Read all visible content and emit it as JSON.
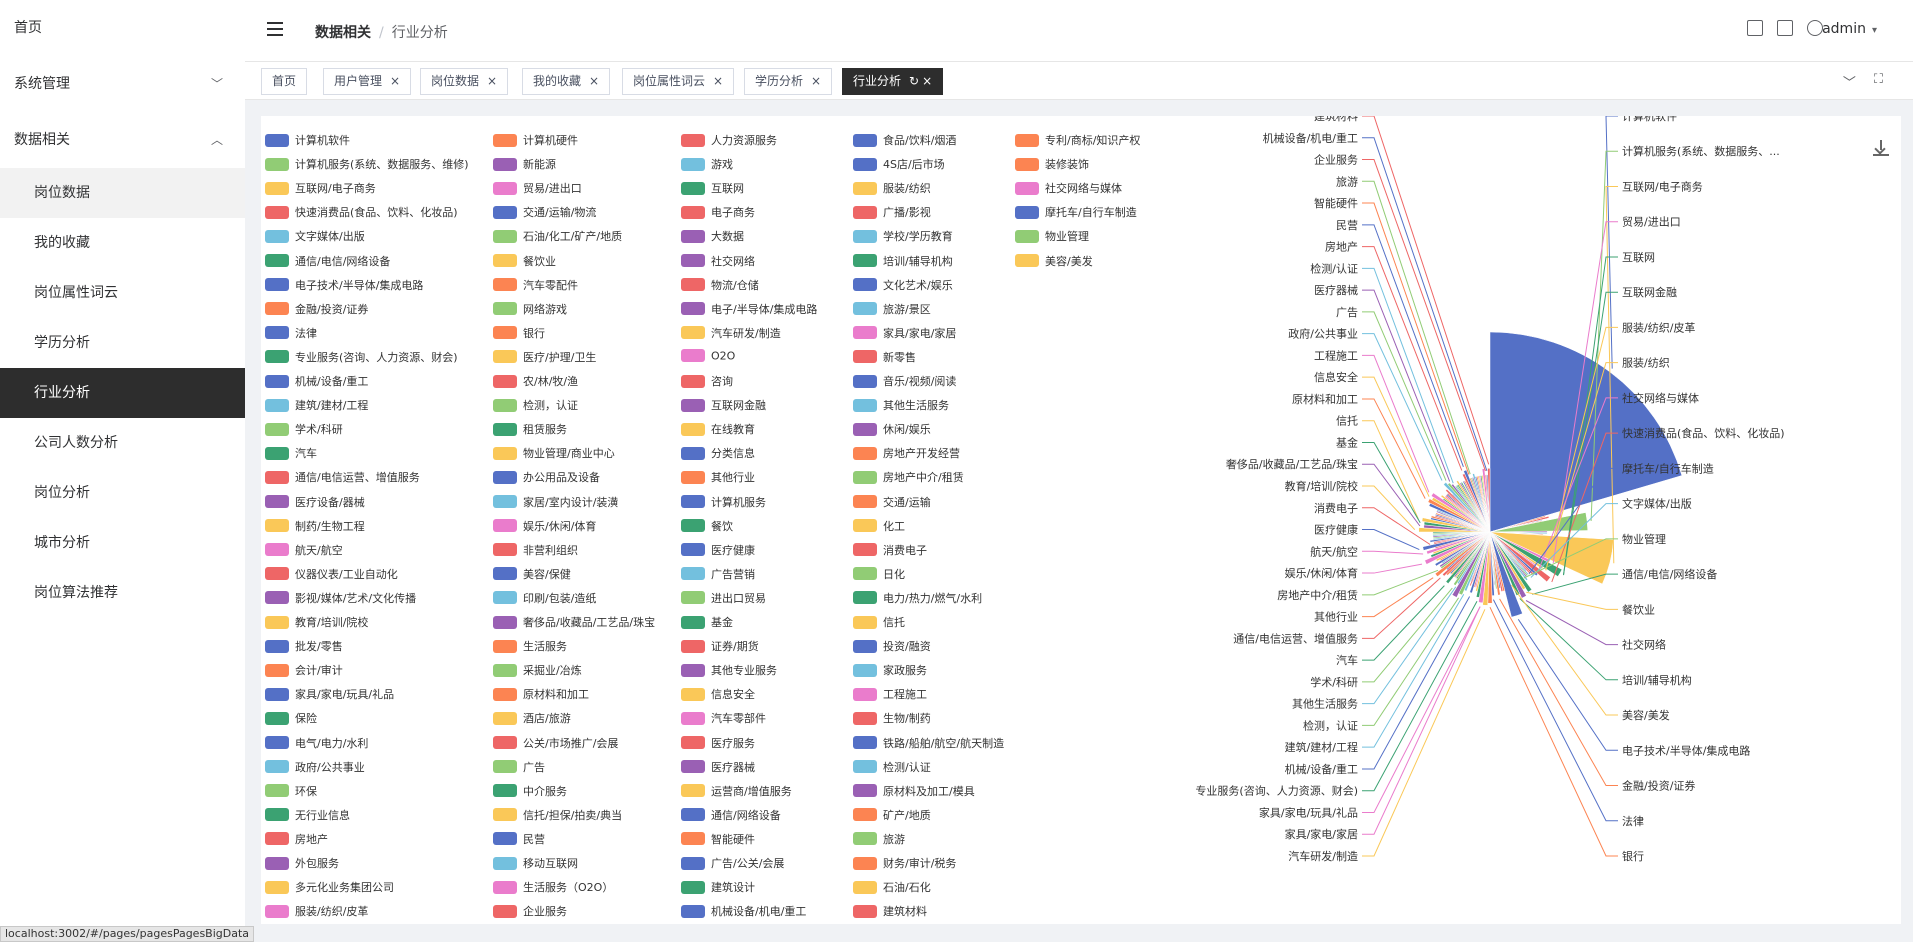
{
  "sidebar": {
    "home": "首页",
    "system": "系统管理",
    "data": "数据相关",
    "items": [
      "岗位数据",
      "我的收藏",
      "岗位属性词云",
      "学历分析",
      "行业分析",
      "公司人数分析",
      "岗位分析",
      "城市分析",
      "岗位算法推荐"
    ]
  },
  "header": {
    "breadcrumb_parent": "数据相关",
    "breadcrumb_current": "行业分析",
    "user": "admin"
  },
  "tabs": [
    "首页",
    "用户管理",
    "岗位数据",
    "我的收藏",
    "岗位属性词云",
    "学历分析",
    "行业分析"
  ],
  "status_url": "localhost:3002/#/pages/pagesPagesBigData",
  "colors": [
    "#5470c6",
    "#fc8452",
    "#ee6666",
    "#5470c6",
    "#fc8452",
    "#91cc75",
    "#9a60b4",
    "#73c0de",
    "#5470c6",
    "#fc8452",
    "#fac858",
    "#ea7ccc",
    "#3ba272",
    "#fac858",
    "#ea7ccc",
    "#ee6666",
    "#5470c6",
    "#ee6666",
    "#ee6666",
    "#5470c6",
    "#73c0de",
    "#91cc75",
    "#9a60b4",
    "#73c0de",
    "#91cc75",
    "#3ba272",
    "#fac858",
    "#9a60b4",
    "#3ba272",
    "#fac858"
  ],
  "chart_data": {
    "type": "pie",
    "title": "",
    "categories": [
      "计算机软件",
      "计算机硬件",
      "人力资源服务",
      "食品/饮料/烟酒",
      "专利/商标/知识产权",
      "计算机服务(系统、数据服务、维修)",
      "新能源",
      "游戏",
      "4S店/后市场",
      "装修装饰",
      "互联网/电子商务",
      "贸易/进出口",
      "互联网",
      "服装/纺织",
      "社交网络与媒体",
      "快速消费品(食品、饮料、化妆品)",
      "交通/运输/物流",
      "电子商务",
      "广播/影视",
      "摩托车/自行车制造",
      "文字媒体/出版",
      "石油/化工/矿产/地质",
      "大数据",
      "学校/学历教育",
      "物业管理",
      "通信/电信/网络设备",
      "餐饮业",
      "社交网络",
      "培训/辅导机构",
      "美容/美发",
      "电子技术/半导体/集成电路",
      "汽车零配件",
      "物流/仓储",
      "文化艺术/娱乐",
      "金融/投资/证券",
      "网络游戏",
      "电子/半导体/集成电路",
      "旅游/景区",
      "法律",
      "银行",
      "汽车研发/制造",
      "家具/家电/家居",
      "专业服务(咨询、人力资源、财会)",
      "医疗/护理/卫生",
      "O2O",
      "新零售",
      "机械/设备/重工",
      "农/林/牧/渔",
      "咨询",
      "音乐/视频/阅读",
      "建筑/建材/工程",
      "检测，认证",
      "互联网金融",
      "其他生活服务",
      "学术/科研",
      "租赁服务",
      "在线教育",
      "休闲/娱乐",
      "汽车",
      "物业管理/商业中心",
      "分类信息",
      "房地产开发经营",
      "通信/电信运营、增值服务",
      "办公用品及设备",
      "其他行业",
      "房地产中介/租赁",
      "医疗设备/器械",
      "家居/室内设计/装潢",
      "计算机服务",
      "交通/运输",
      "制药/生物工程",
      "娱乐/休闲/体育",
      "餐饮",
      "化工",
      "航天/航空",
      "非营利组织",
      "医疗健康",
      "消费电子",
      "仪器仪表/工业自动化",
      "美容/保健",
      "广告营销",
      "日化",
      "影视/媒体/艺术/文化传播",
      "印刷/包装/造纸",
      "进出口贸易",
      "电力/热力/燃气/水利",
      "教育/培训/院校",
      "奢侈品/收藏品/工艺品/珠宝",
      "基金",
      "信托",
      "批发/零售",
      "生活服务",
      "证券/期货",
      "投资/融资",
      "会计/审计",
      "采掘业/冶炼",
      "其他专业服务",
      "家政服务",
      "家具/家电/玩具/礼品",
      "原材料和加工",
      "信息安全",
      "工程施工",
      "保险",
      "酒店/旅游",
      "汽车零部件",
      "生物/制药",
      "电气/电力/水利",
      "公关/市场推广/会展",
      "医疗服务",
      "铁路/船舶/航空/航天制造",
      "政府/公共事业",
      "广告",
      "医疗器械",
      "检测/认证",
      "环保",
      "中介服务",
      "运营商/增值服务",
      "原材料及加工/模具",
      "无行业信息",
      "信托/担保/拍卖/典当",
      "通信/网络设备",
      "矿产/地质",
      "房地产",
      "民营",
      "智能硬件",
      "旅游",
      "外包服务",
      "移动互联网",
      "广告/公关/会展",
      "财务/审计/税务",
      "多元化业务集团公司",
      "生活服务（O2O）",
      "建筑设计",
      "石油/石化",
      "服装/纺织/皮革",
      "企业服务",
      "机械设备/机电/重工",
      "建筑材料"
    ],
    "values": [
      166,
      3,
      4,
      2,
      2,
      24,
      3,
      3,
      2,
      2,
      48,
      6,
      13,
      5,
      3,
      10,
      5,
      4,
      3,
      2,
      3,
      3,
      3,
      4,
      2,
      8,
      6,
      9,
      7,
      2,
      17,
      4,
      4,
      3,
      5,
      3,
      2,
      2,
      5,
      8,
      9,
      8,
      6,
      4,
      3,
      3,
      5,
      2,
      3,
      2,
      5,
      7,
      9,
      4,
      5,
      3,
      3,
      3,
      6,
      3,
      3,
      4,
      5,
      3,
      7,
      4,
      4,
      3,
      5,
      3,
      4,
      8,
      5,
      4,
      6,
      3,
      7,
      3,
      3,
      4,
      3,
      3,
      3,
      3,
      3,
      3,
      8,
      6,
      6,
      7,
      4,
      4,
      3,
      3,
      3,
      2,
      3,
      3,
      6,
      7,
      6,
      7,
      3,
      4,
      3,
      3,
      3,
      3,
      4,
      2,
      6,
      5,
      4,
      3,
      3,
      3,
      4,
      3,
      3,
      2,
      3,
      3,
      5,
      6,
      3,
      3,
      3,
      4,
      3,
      3,
      3,
      3,
      3,
      3,
      5,
      3,
      3,
      5
    ],
    "labeled": [
      "计算机软件",
      "计算机服务(系统、数据服务、...",
      "互联网/电子商务",
      "快速消费品(食品、饮料、化妆品)",
      "文字媒体/出版",
      "通信/电信/网络设备",
      "电子技术/半导体/集成电路",
      "金融/投资/证券",
      "法律",
      "专业服务(咨询、人力资源、财会)",
      "机械/设备/重工",
      "建筑/建材/工程",
      "学术/科研",
      "汽车",
      "通信/电信运营、增值服务",
      "航天/航空",
      "教育/培训/院校",
      "家具/家电/玩具/礼品",
      "政府/公共事业",
      "房地产",
      "服装/纺织/皮革",
      "贸易/进出口",
      "餐饮业",
      "银行",
      "检测，认证",
      "娱乐/休闲/体育",
      "奢侈品/收藏品/工艺品/珠宝",
      "原材料和加工",
      "广告",
      "民营",
      "企业服务",
      "互联网",
      "社交网络",
      "汽车研发/制造",
      "互联网金融",
      "其他行业",
      "医疗健康",
      "基金",
      "信息安全",
      "医疗器械",
      "智能硬件",
      "机械设备/机电/重工",
      "服装/纺织",
      "培训/辅导机构",
      "家具/家电/家居",
      "其他生活服务",
      "房地产中介/租赁",
      "消费电子",
      "信托",
      "工程施工",
      "检测/认证",
      "旅游",
      "建筑材料",
      "社交网络与媒体",
      "摩托车/自行车制造",
      "物业管理",
      "美容/美发"
    ]
  }
}
